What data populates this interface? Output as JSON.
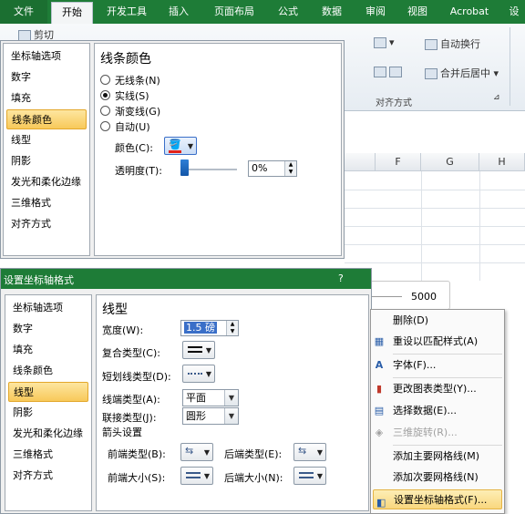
{
  "ribbon": {
    "tabs": [
      "文件",
      "开始",
      "开发工具",
      "插入",
      "页面布局",
      "公式",
      "数据",
      "审阅",
      "视图",
      "Acrobat",
      "设"
    ],
    "active_tab": "开始",
    "cut_label": "剪切",
    "wrap_text": "自动换行",
    "merge_center": "合并后居中",
    "alignment_group": "对齐方式"
  },
  "sheet": {
    "columns": [
      "F",
      "G",
      "H"
    ],
    "axis_value": "5000"
  },
  "dialog_top": {
    "nav": [
      "坐标轴选项",
      "数字",
      "填充",
      "线条颜色",
      "线型",
      "阴影",
      "发光和柔化边缘",
      "三维格式",
      "对齐方式"
    ],
    "selected": "线条颜色",
    "panel_title": "线条颜色",
    "options": [
      "无线条(N)",
      "实线(S)",
      "渐变线(G)",
      "自动(U)"
    ],
    "selected_option": "实线(S)",
    "color_label": "颜色(C):",
    "transparency_label": "透明度(T):",
    "transparency_value": "0%",
    "accent_color": "#e2231a"
  },
  "dialog_bottom": {
    "title": "设置坐标轴格式",
    "help": "?",
    "nav": [
      "坐标轴选项",
      "数字",
      "填充",
      "线条颜色",
      "线型",
      "阴影",
      "发光和柔化边缘",
      "三维格式",
      "对齐方式"
    ],
    "selected": "线型",
    "panel_title": "线型",
    "width_label": "宽度(W):",
    "width_value": "1.5 磅",
    "compound_label": "复合类型(C):",
    "dash_label": "短划线类型(D):",
    "cap_label": "线端类型(A):",
    "cap_value": "平面",
    "join_label": "联接类型(J):",
    "join_value": "圆形",
    "arrow_section": "箭头设置",
    "begin_type": "前端类型(B):",
    "end_type": "后端类型(E):",
    "begin_size": "前端大小(S):",
    "end_size": "后端大小(N):"
  },
  "context_menu": {
    "items": [
      "删除(D)",
      "重设以匹配样式(A)",
      "字体(F)...",
      "更改图表类型(Y)...",
      "选择数据(E)...",
      "三维旋转(R)...",
      "添加主要网格线(M)",
      "添加次要网格线(N)",
      "设置坐标轴格式(F)..."
    ],
    "disabled": "三维旋转(R)...",
    "highlighted": "设置坐标轴格式(F)..."
  }
}
